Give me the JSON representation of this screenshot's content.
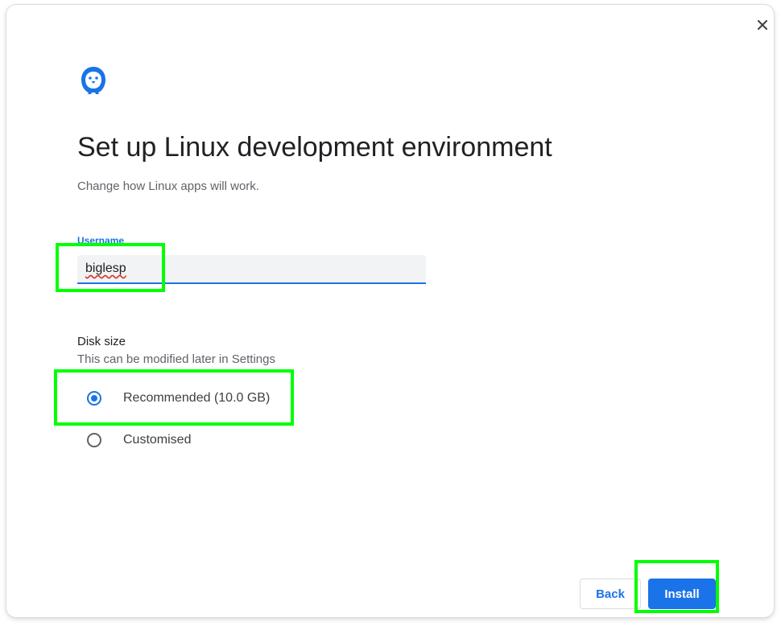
{
  "dialog": {
    "title": "Set up Linux development environment",
    "subtitle": "Change how Linux apps will work.",
    "close_icon": "close-icon",
    "logo_icon": "penguin-icon"
  },
  "username": {
    "label": "Username",
    "value": "biglesp"
  },
  "disk": {
    "heading": "Disk size",
    "subheading": "This can be modified later in Settings",
    "options": [
      {
        "label": "Recommended (10.0 GB)",
        "selected": true
      },
      {
        "label": "Customised",
        "selected": false
      }
    ]
  },
  "buttons": {
    "back_label": "Back",
    "install_label": "Install"
  },
  "colors": {
    "accent": "#1a73e8",
    "highlight": "#00ff00"
  }
}
